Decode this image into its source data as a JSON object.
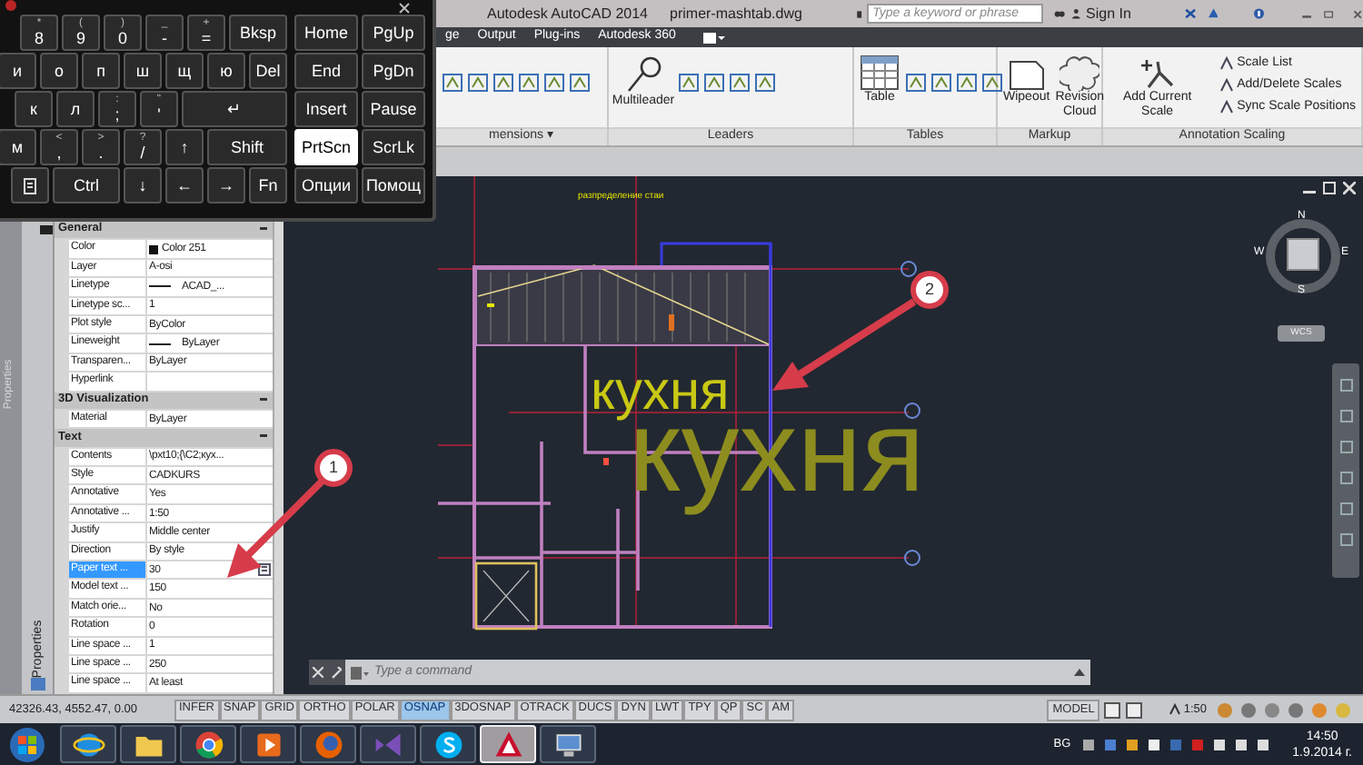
{
  "window": {
    "title": "Autodesk AutoCAD 2014",
    "file": "primer-mashtab.dwg"
  },
  "search": {
    "placeholder": "Type a keyword or phrase"
  },
  "sign_in": "Sign In",
  "ribbon_tabs": [
    {
      "label": "ge",
      "selected": false
    },
    {
      "label": "Output",
      "selected": false
    },
    {
      "label": "Plug-ins",
      "selected": false
    },
    {
      "label": "Autodesk 360",
      "selected": false
    }
  ],
  "ribbon_panels": [
    {
      "title": "mensions ▾"
    },
    {
      "title": "Leaders",
      "tools": [
        {
          "kind": "multileader",
          "label": "Multileader"
        }
      ]
    },
    {
      "title": "Tables",
      "tools": [
        {
          "kind": "table",
          "label": "Table"
        }
      ]
    },
    {
      "title": "Markup",
      "tools": [
        {
          "kind": "wipeout",
          "label": "Wipeout"
        },
        {
          "kind": "revcloud",
          "label": "Revision Cloud"
        }
      ]
    },
    {
      "title": "Annotation Scaling",
      "tools": [
        {
          "kind": "addscale",
          "label": "Add Current Scale"
        }
      ],
      "small_tools": [
        "Scale List",
        "Add/Delete Scales",
        "Sync Scale Positions"
      ]
    }
  ],
  "keyboard": {
    "rows": [
      {
        "keys": [
          {
            "kind": "char",
            "alt": "*",
            "label": "8",
            "selected": false
          },
          {
            "kind": "char",
            "alt": "(",
            "label": "9",
            "selected": false
          },
          {
            "kind": "char",
            "alt": ")",
            "label": "0",
            "selected": false
          },
          {
            "kind": "char",
            "alt": "_",
            "label": "-",
            "selected": false
          },
          {
            "kind": "char",
            "alt": "+",
            "label": "=",
            "selected": false
          },
          {
            "kind": "bksp",
            "label": "Bksp",
            "selected": false
          }
        ],
        "nav": [
          {
            "kind": "nav",
            "label": "Home",
            "selected": false
          },
          {
            "kind": "nav",
            "label": "PgUp",
            "selected": false
          }
        ]
      },
      {
        "keys": [
          {
            "kind": "char",
            "label": "и",
            "selected": false
          },
          {
            "kind": "char",
            "label": "о",
            "selected": false
          },
          {
            "kind": "char",
            "label": "п",
            "selected": false
          },
          {
            "kind": "char",
            "label": "ш",
            "selected": false
          },
          {
            "kind": "char",
            "label": "щ",
            "selected": false
          },
          {
            "kind": "char",
            "label": "ю",
            "selected": false
          },
          {
            "kind": "char",
            "label": "Del",
            "selected": false
          }
        ],
        "nav": [
          {
            "kind": "nav",
            "label": "End",
            "selected": false
          },
          {
            "kind": "nav",
            "label": "PgDn",
            "selected": false
          }
        ]
      },
      {
        "keys": [
          {
            "kind": "char",
            "label": "к",
            "selected": false
          },
          {
            "kind": "char",
            "label": "л",
            "selected": false
          },
          {
            "kind": "char",
            "alt": ":",
            "label": ";",
            "selected": false
          },
          {
            "kind": "char",
            "alt": "\"",
            "label": "'",
            "selected": false
          },
          {
            "kind": "enter",
            "label": "↵",
            "selected": false
          }
        ],
        "nav": [
          {
            "kind": "nav",
            "label": "Insert",
            "selected": false
          },
          {
            "kind": "nav",
            "label": "Pause",
            "selected": false
          }
        ]
      },
      {
        "keys": [
          {
            "kind": "char",
            "label": "м",
            "selected": false
          },
          {
            "kind": "char",
            "alt": "<",
            "label": ",",
            "selected": false
          },
          {
            "kind": "char",
            "alt": ">",
            "label": ".",
            "selected": false
          },
          {
            "kind": "char",
            "alt": "?",
            "label": "/",
            "selected": false
          },
          {
            "kind": "char",
            "label": "↑",
            "selected": false
          },
          {
            "kind": "shift",
            "label": "Shift",
            "selected": false
          }
        ],
        "nav": [
          {
            "kind": "nav",
            "label": "PrtScn",
            "selected": true
          },
          {
            "kind": "nav",
            "label": "ScrLk",
            "selected": false
          }
        ]
      },
      {
        "keys": [
          {
            "kind": "menu",
            "selected": false
          },
          {
            "kind": "ctrl",
            "label": "Ctrl",
            "selected": false
          },
          {
            "kind": "char",
            "label": "↓",
            "selected": false
          },
          {
            "kind": "char",
            "label": "←",
            "selected": false
          },
          {
            "kind": "char",
            "label": "→",
            "selected": false
          },
          {
            "kind": "char",
            "label": "Fn",
            "selected": false
          }
        ],
        "nav": [
          {
            "kind": "nav",
            "label": "Опции",
            "selected": false
          },
          {
            "kind": "nav",
            "label": "Помощ",
            "selected": false
          }
        ]
      }
    ]
  },
  "properties": {
    "title": "Properties",
    "side_label": "Properties",
    "sections": [
      {
        "title": "General",
        "rows": [
          {
            "name": "Color",
            "value": "Color 251",
            "kind": "swatch",
            "selected": false
          },
          {
            "name": "Layer",
            "value": "A-osi",
            "kind": "text",
            "selected": false
          },
          {
            "name": "Linetype",
            "value": "ACAD_...",
            "kind": "line",
            "selected": false
          },
          {
            "name": "Linetype sc...",
            "value": "1",
            "kind": "text",
            "selected": false
          },
          {
            "name": "Plot style",
            "value": "ByColor",
            "kind": "text",
            "selected": false
          },
          {
            "name": "Lineweight",
            "value": "ByLayer",
            "kind": "line",
            "selected": false
          },
          {
            "name": "Transparen...",
            "value": "ByLayer",
            "kind": "text",
            "selected": false
          },
          {
            "name": "Hyperlink",
            "kind": "text",
            "selected": false
          }
        ]
      },
      {
        "title": "3D Visualization",
        "rows": [
          {
            "name": "Material",
            "value": "ByLayer",
            "kind": "text",
            "selected": false
          }
        ]
      },
      {
        "title": "Text",
        "rows": [
          {
            "name": "Contents",
            "value": "\\pxt10;{\\C2;кух...",
            "kind": "text",
            "selected": false
          },
          {
            "name": "Style",
            "value": "CADKURS",
            "kind": "text",
            "selected": false
          },
          {
            "name": "Annotative",
            "value": "Yes",
            "kind": "text",
            "selected": false
          },
          {
            "name": "Annotative ...",
            "value": "1:50",
            "kind": "text",
            "selected": false
          },
          {
            "name": "Justify",
            "value": "Middle center",
            "kind": "text",
            "selected": false
          },
          {
            "name": "Direction",
            "value": "By style",
            "kind": "text",
            "selected": false
          },
          {
            "name": "Paper text ...",
            "value": "30",
            "kind": "calc",
            "selected": true
          },
          {
            "name": "Model text ...",
            "value": "150",
            "kind": "text",
            "selected": false
          },
          {
            "name": "Match orie...",
            "value": "No",
            "kind": "text",
            "selected": false
          },
          {
            "name": "Rotation",
            "value": "0",
            "kind": "text",
            "selected": false
          },
          {
            "name": "Line space ...",
            "value": "1",
            "kind": "text",
            "selected": false
          },
          {
            "name": "Line space ...",
            "value": "250",
            "kind": "text",
            "selected": false
          },
          {
            "name": "Line space ...",
            "value": "At least",
            "kind": "text",
            "selected": false
          }
        ]
      }
    ]
  },
  "drawing": {
    "plan_title": "разпределение стаи",
    "room_label_small": "кухня",
    "room_label_large": "кухня",
    "compass": [
      "N",
      "W",
      "E",
      "S"
    ],
    "ucs": "WCS"
  },
  "callouts": [
    "1",
    "2"
  ],
  "command_line": {
    "placeholder": "Type a command"
  },
  "status_bar": {
    "coordinates": "42326.43, 4552.47, 0.00",
    "toggles": [
      {
        "label": "INFER",
        "on": false
      },
      {
        "label": "SNAP",
        "on": false
      },
      {
        "label": "GRID",
        "on": false
      },
      {
        "label": "ORTHO",
        "on": false
      },
      {
        "label": "POLAR",
        "on": false
      },
      {
        "label": "OSNAP",
        "on": true
      },
      {
        "label": "3DOSNAP",
        "on": false
      },
      {
        "label": "OTRACK",
        "on": false
      },
      {
        "label": "DUCS",
        "on": false
      },
      {
        "label": "DYN",
        "on": false
      },
      {
        "label": "LWT",
        "on": false
      },
      {
        "label": "TPY",
        "on": false
      },
      {
        "label": "QP",
        "on": false
      },
      {
        "label": "SC",
        "on": false
      },
      {
        "label": "AM",
        "on": false
      }
    ],
    "model": "MODEL",
    "scale": "1:50"
  },
  "taskbar": {
    "apps": [
      {
        "kind": "ie",
        "selected": false
      },
      {
        "kind": "folder",
        "selected": false
      },
      {
        "kind": "chrome",
        "selected": false
      },
      {
        "kind": "player",
        "selected": false
      },
      {
        "kind": "firefox",
        "selected": false
      },
      {
        "kind": "vs",
        "selected": false
      },
      {
        "kind": "skype",
        "selected": false
      },
      {
        "kind": "autocad",
        "selected": true
      },
      {
        "kind": "network",
        "selected": false
      }
    ],
    "language": "BG",
    "time": "14:50",
    "date": "1.9.2014 г."
  }
}
